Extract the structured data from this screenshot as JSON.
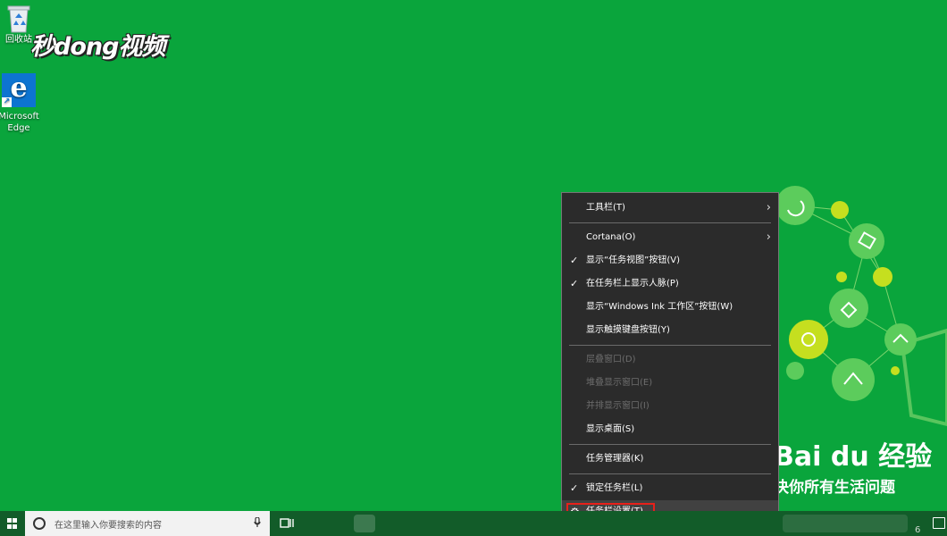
{
  "desktop": {
    "icons": [
      {
        "label": "回收站"
      },
      {
        "label": "Microsoft Edge",
        "glyph": "e"
      }
    ],
    "brand_logo": "秒dong视频",
    "watermark": {
      "title": "Bai du 经验",
      "subtitle": "决你所有生活问题"
    }
  },
  "context_menu": {
    "items": [
      {
        "label": "工具栏(T)",
        "submenu": true,
        "checked": false,
        "disabled": false
      },
      {
        "separator": true
      },
      {
        "label": "Cortana(O)",
        "submenu": true,
        "checked": false,
        "disabled": false
      },
      {
        "label": "显示“任务视图”按钮(V)",
        "checked": true,
        "disabled": false
      },
      {
        "label": "在任务栏上显示人脉(P)",
        "checked": true,
        "disabled": false
      },
      {
        "label": "显示“Windows Ink 工作区”按钮(W)",
        "checked": false,
        "disabled": false
      },
      {
        "label": "显示触摸键盘按钮(Y)",
        "checked": false,
        "disabled": false
      },
      {
        "separator": true
      },
      {
        "label": "层叠窗口(D)",
        "checked": false,
        "disabled": true
      },
      {
        "label": "堆叠显示窗口(E)",
        "checked": false,
        "disabled": true
      },
      {
        "label": "并排显示窗口(I)",
        "checked": false,
        "disabled": true
      },
      {
        "label": "显示桌面(S)",
        "checked": false,
        "disabled": false
      },
      {
        "separator": true
      },
      {
        "label": "任务管理器(K)",
        "checked": false,
        "disabled": false
      },
      {
        "separator": true
      },
      {
        "label": "锁定任务栏(L)",
        "checked": true,
        "disabled": false
      },
      {
        "label": "任务栏设置(T)",
        "checked": false,
        "disabled": false,
        "gear": true,
        "hovered": true
      }
    ],
    "check_glyph": "✓",
    "arrow_glyph": "›",
    "gear_glyph": "⚙"
  },
  "taskbar": {
    "search_placeholder": "在这里输入你要搜索的内容",
    "mic_glyph": "🎙",
    "tray_text": "6"
  },
  "colors": {
    "desktop": "#0aa53c",
    "menu_bg": "#2b2b2b",
    "highlight": "#e8201a",
    "taskbar": "#125c29"
  }
}
